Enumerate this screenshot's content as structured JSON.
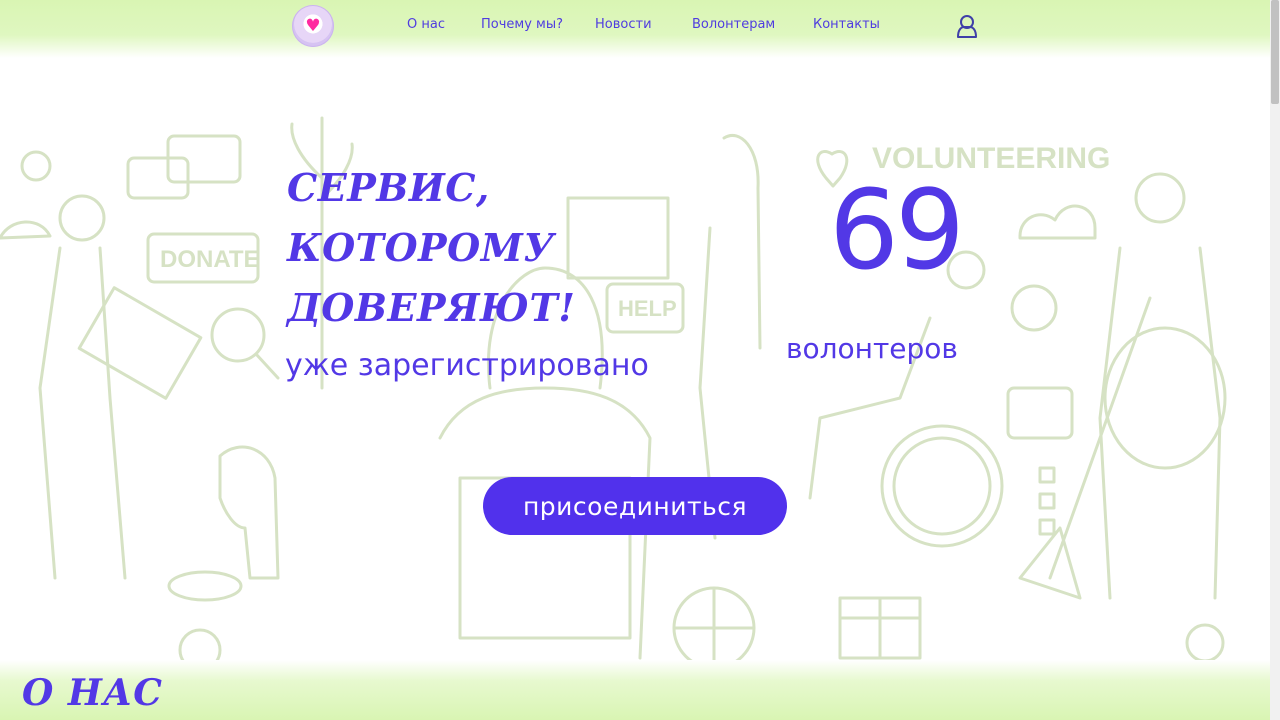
{
  "header": {
    "logo_icon": "heart-logo",
    "nav": [
      {
        "label": "О нас"
      },
      {
        "label": "Почему мы?"
      },
      {
        "label": "Новости"
      },
      {
        "label": "Волонтерам"
      },
      {
        "label": "Контакты"
      }
    ],
    "user_icon": "user-icon"
  },
  "hero": {
    "title_line1": "СЕРВИС, КОТОРОМУ",
    "title_line2": "ДОВЕРЯЮТ!",
    "registered_label": "уже зарегистрировано",
    "volunteer_count": "69",
    "volunteer_unit": "волонтеров",
    "join_button": "присоединиться",
    "illustration_words": {
      "volunteering": "VOLUNTEERING",
      "donate": "DONATE",
      "help": "HELP"
    }
  },
  "section": {
    "title": "О НАС"
  },
  "colors": {
    "accent": "#5238e6",
    "button": "#5131ec",
    "header_bg": "#d9f5b3",
    "illustration": "#d6e2c4",
    "logo_heart": "#ff2aa0"
  }
}
